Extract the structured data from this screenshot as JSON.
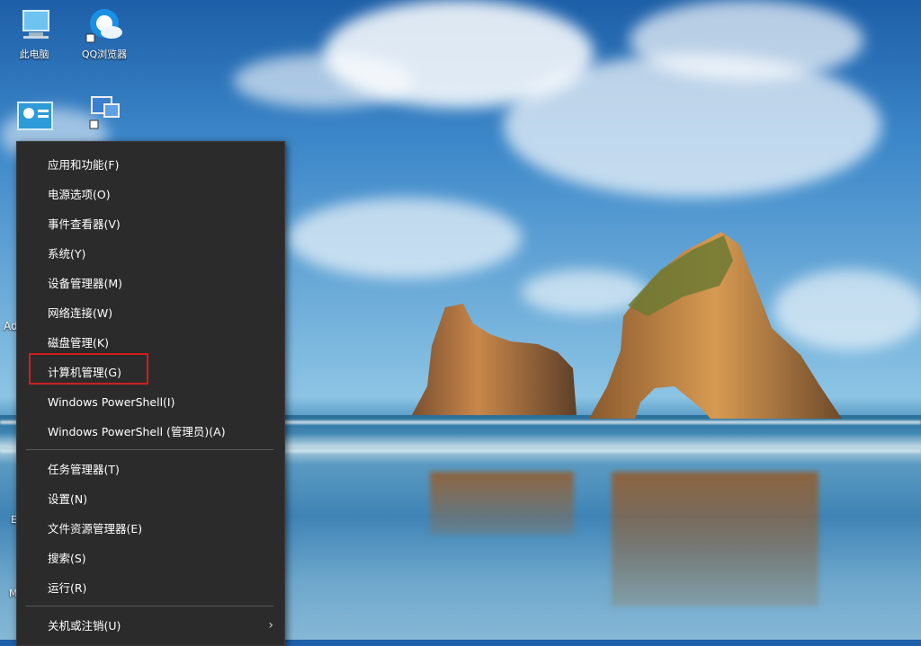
{
  "desktop": {
    "icons": [
      {
        "label": "此电脑",
        "icon": "computer-icon"
      },
      {
        "label": "QQ浏览器",
        "icon": "qq-browser-icon"
      },
      {
        "label": "",
        "icon": "control-panel-icon"
      },
      {
        "label": "",
        "icon": "network-icon"
      }
    ],
    "edge_text": {
      "ad": "Ad",
      "e": "E",
      "m": "M"
    }
  },
  "context_menu": {
    "group1": [
      {
        "label": "应用和功能(F)"
      },
      {
        "label": "电源选项(O)"
      },
      {
        "label": "事件查看器(V)"
      },
      {
        "label": "系统(Y)"
      },
      {
        "label": "设备管理器(M)"
      },
      {
        "label": "网络连接(W)"
      },
      {
        "label": "磁盘管理(K)"
      },
      {
        "label": "计算机管理(G)",
        "highlighted": true
      },
      {
        "label": "Windows PowerShell(I)"
      },
      {
        "label": "Windows PowerShell (管理员)(A)"
      }
    ],
    "group2": [
      {
        "label": "任务管理器(T)"
      },
      {
        "label": "设置(N)"
      },
      {
        "label": "文件资源管理器(E)"
      },
      {
        "label": "搜索(S)"
      },
      {
        "label": "运行(R)"
      }
    ],
    "group3": [
      {
        "label": "关机或注销(U)",
        "submenu_icon": "chevron-right-icon"
      }
    ]
  },
  "colors": {
    "menu_bg": "#2b2b2b",
    "menu_text": "#ffffff",
    "highlight_border": "#d01e1e"
  }
}
